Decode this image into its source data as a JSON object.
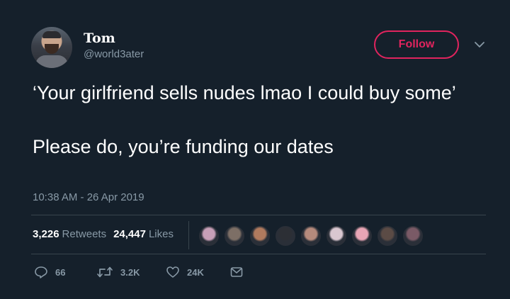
{
  "tweet": {
    "author_name": "Tom",
    "author_handle": "@world3ater",
    "follow_label": "Follow",
    "text": "‘Your girlfriend sells nudes lmao I could buy some’\n\nPlease do, you’re funding our dates",
    "timestamp": "10:38 AM - 26 Apr 2019"
  },
  "stats": {
    "retweets_count": "3,226",
    "retweets_label": "Retweets",
    "likes_count": "24,447",
    "likes_label": "Likes"
  },
  "likers": {
    "avatar_colors": [
      "#c79fb7",
      "#7d6f66",
      "#b07a5e",
      "#2c2f35",
      "#b58a7c",
      "#d9c7d0",
      "#e8a5b5",
      "#5b4b45",
      "#7a5a66"
    ]
  },
  "actions": {
    "replies": "66",
    "retweets": "3.2K",
    "likes": "24K"
  },
  "colors": {
    "background": "#15202b",
    "follow_accent": "#e0245e",
    "secondary_text": "#8899a6",
    "divider": "#38444d"
  }
}
